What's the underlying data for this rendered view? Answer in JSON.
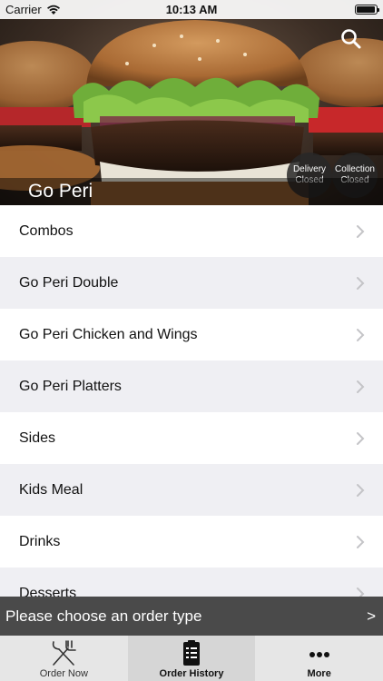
{
  "status_bar": {
    "carrier": "Carrier",
    "time": "10:13 AM",
    "battery_level": 0.95
  },
  "hero": {
    "restaurant_name": "Go Peri",
    "search_icon": "search-icon",
    "delivery": {
      "line1": "Delivery",
      "line2": "Closed"
    },
    "collection": {
      "line1": "Collection",
      "line2": "Closed"
    }
  },
  "menu": {
    "items": [
      {
        "label": "Combos"
      },
      {
        "label": "Go Peri Double"
      },
      {
        "label": "Go Peri Chicken and Wings"
      },
      {
        "label": "Go Peri Platters"
      },
      {
        "label": "Sides"
      },
      {
        "label": "Kids Meal"
      },
      {
        "label": "Drinks"
      },
      {
        "label": "Desserts"
      }
    ]
  },
  "order_bar": {
    "label": "Please choose an order type",
    "arrow": ">"
  },
  "tabs": [
    {
      "label": "Order Now",
      "icon": "fork-knife-icon"
    },
    {
      "label": "Order History",
      "icon": "clipboard-list-icon"
    },
    {
      "label": "More",
      "icon": "more-dots-icon"
    }
  ],
  "colors": {
    "order_bar": "#4a4a4a",
    "tab_bar": "#e6e6e6",
    "row_alt": "#efeff3"
  }
}
